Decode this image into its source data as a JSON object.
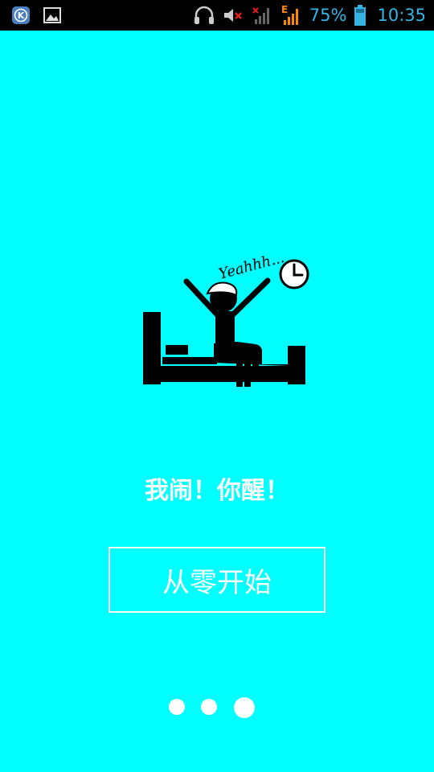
{
  "status_bar": {
    "battery_percent": "75%",
    "time": "10:35",
    "icons": [
      "kuaiya-app-icon",
      "image-notification-icon",
      "headphones-icon",
      "mute-icon",
      "signal-no-service-icon",
      "signal-edge-icon",
      "battery-icon"
    ],
    "signal_label": "E"
  },
  "illustration": {
    "caption": "Yeahhh..."
  },
  "tagline": "我闹！你醒！",
  "start_button": {
    "label": "从零开始"
  },
  "page_indicator": {
    "count": 3,
    "active_index": 2
  },
  "colors": {
    "background": "#00FFFF",
    "status_bar": "#000000",
    "status_accent": "#33B5E5",
    "edge_signal": "#FF8800"
  }
}
